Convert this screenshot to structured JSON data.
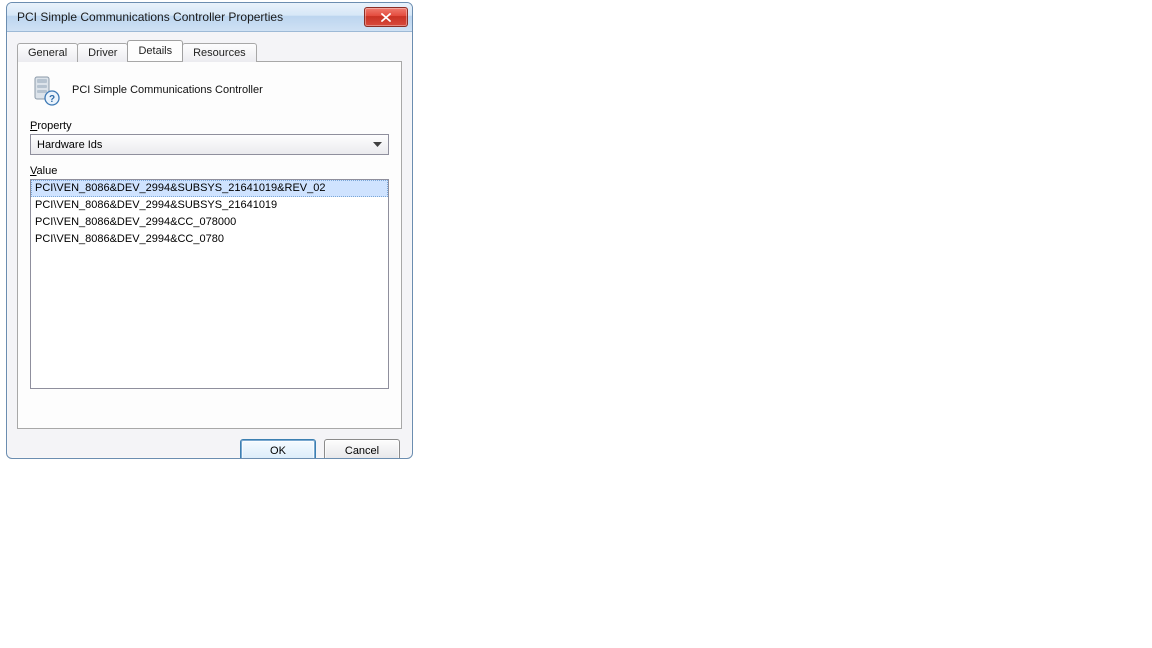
{
  "window": {
    "title": "PCI Simple Communications Controller Properties"
  },
  "tabs": {
    "general": "General",
    "driver": "Driver",
    "details": "Details",
    "resources": "Resources",
    "active": "details"
  },
  "device": {
    "name": "PCI Simple Communications Controller"
  },
  "property": {
    "label_prefix": "P",
    "label_rest": "roperty",
    "selected": "Hardware Ids"
  },
  "value": {
    "label_prefix": "V",
    "label_rest": "alue",
    "items": [
      "PCI\\VEN_8086&DEV_2994&SUBSYS_21641019&REV_02",
      "PCI\\VEN_8086&DEV_2994&SUBSYS_21641019",
      "PCI\\VEN_8086&DEV_2994&CC_078000",
      "PCI\\VEN_8086&DEV_2994&CC_0780"
    ],
    "selected_index": 0
  },
  "buttons": {
    "ok": "OK",
    "cancel": "Cancel"
  }
}
